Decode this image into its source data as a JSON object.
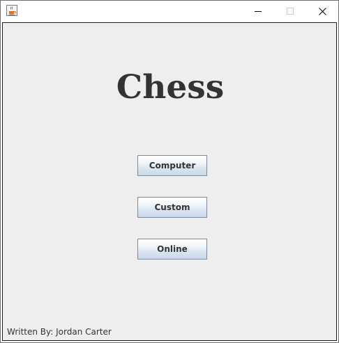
{
  "window": {
    "title": "",
    "icon": "java-coffee-cup-icon",
    "controls": {
      "minimize": "minimize-icon",
      "maximize": "maximize-icon",
      "close": "close-icon"
    }
  },
  "main": {
    "title": "Chess",
    "buttons": {
      "computer": "Computer",
      "custom": "Custom",
      "online": "Online"
    },
    "credit": "Written By: Jordan Carter"
  },
  "colors": {
    "panel_background": "#eeeeee",
    "text": "#333333",
    "button_border": "#7a8a99"
  }
}
